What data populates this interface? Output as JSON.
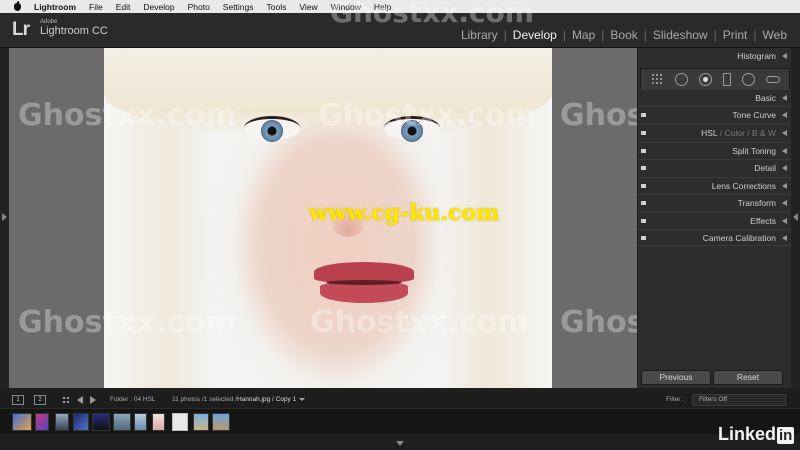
{
  "menubar": {
    "app_name": "Lightroom",
    "items": [
      "File",
      "Edit",
      "Develop",
      "Photo",
      "Settings",
      "Tools",
      "View",
      "Window",
      "Help"
    ]
  },
  "brand": {
    "logo": "Lr",
    "line1": "Adobe",
    "line2": "Lightroom CC"
  },
  "modules": [
    {
      "label": "Library",
      "active": false
    },
    {
      "label": "Develop",
      "active": true
    },
    {
      "label": "Map",
      "active": false
    },
    {
      "label": "Book",
      "active": false
    },
    {
      "label": "Slideshow",
      "active": false
    },
    {
      "label": "Print",
      "active": false
    },
    {
      "label": "Web",
      "active": false
    }
  ],
  "photo_overlay_text": "www.cg-ku.com",
  "watermark_text": "Ghostxx.com",
  "right_panel": {
    "histogram": "Histogram",
    "sections": {
      "basic": "Basic",
      "tone_curve": "Tone Curve",
      "hsl": "HSL",
      "hsl_sep1": "/",
      "color": "Color",
      "hsl_sep2": "/",
      "bw": "B & W",
      "split_toning": "Split Toning",
      "detail": "Detail",
      "lens_corrections": "Lens Corrections",
      "transform": "Transform",
      "effects": "Effects",
      "camera_calibration": "Camera Calibration"
    },
    "tools": [
      "grid-overlay-icon",
      "crop-overlay-icon",
      "spot-removal-icon",
      "red-eye-icon",
      "graduated-filter-icon",
      "radial-filter-icon",
      "adjustment-brush-icon"
    ],
    "previous_button": "Previous",
    "reset_button": "Reset"
  },
  "filmbar": {
    "monitor1": "1",
    "monitor2": "2",
    "folder": "Folder : 04 HSL",
    "count": "11 photos /1 selected /",
    "filename": "Hannah.jpg / Copy 1",
    "filter_label": "Filter :",
    "filter_value": "Filters Off"
  },
  "linkedin": {
    "text": "Linked",
    "in": "in"
  }
}
